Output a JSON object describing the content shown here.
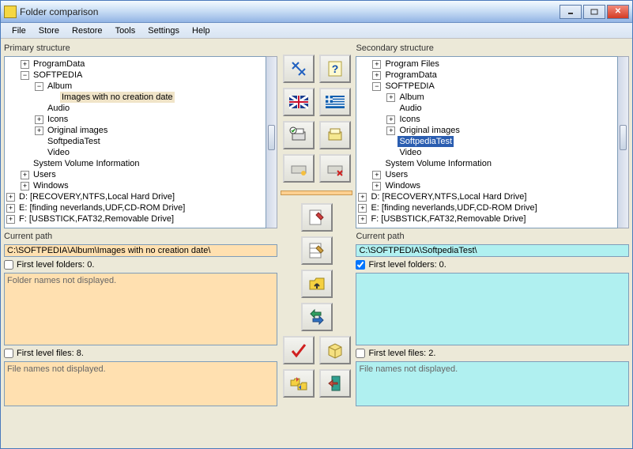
{
  "window": {
    "title": "Folder comparison"
  },
  "menu": {
    "file": "File",
    "store": "Store",
    "restore": "Restore",
    "tools": "Tools",
    "settings": "Settings",
    "help": "Help"
  },
  "primary": {
    "structure_label": "Primary structure",
    "tree": {
      "programdata": "ProgramData",
      "softpedia": "SOFTPEDIA",
      "album": "Album",
      "images_no_date": "Images with no creation date",
      "audio": "Audio",
      "icons": "Icons",
      "original_images": "Original images",
      "softpediatest": "SoftpediaTest",
      "video": "Video",
      "sysvol": "System Volume Information",
      "users": "Users",
      "windows": "Windows",
      "drive_d": "D: [RECOVERY,NTFS,Local Hard Drive]",
      "drive_e": "E: [finding neverlands,UDF,CD-ROM Drive]",
      "drive_f": "F: [USBSTICK,FAT32,Removable Drive]"
    },
    "current_path_label": "Current path",
    "current_path": "C:\\SOFTPEDIA\\Album\\Images with no creation date\\",
    "folders_label": "First level folders:  0.",
    "folders_msg": "Folder names not displayed.",
    "files_label": "First level files:  8.",
    "files_msg": "File names not displayed."
  },
  "secondary": {
    "structure_label": "Secondary structure",
    "tree": {
      "program_files": "Program Files",
      "programdata": "ProgramData",
      "softpedia": "SOFTPEDIA",
      "album": "Album",
      "audio": "Audio",
      "icons": "Icons",
      "original_images": "Original images",
      "softpediatest": "SoftpediaTest",
      "video": "Video",
      "sysvol": "System Volume Information",
      "users": "Users",
      "windows": "Windows",
      "drive_d": "D: [RECOVERY,NTFS,Local Hard Drive]",
      "drive_e": "E: [finding neverlands,UDF,CD-ROM Drive]",
      "drive_f": "F: [USBSTICK,FAT32,Removable Drive]"
    },
    "current_path_label": "Current path",
    "current_path": "C:\\SOFTPEDIA\\SoftpediaTest\\",
    "folders_label": "First level folders:  0.",
    "files_label": "First level files:  2.",
    "files_msg": "File names not displayed."
  }
}
